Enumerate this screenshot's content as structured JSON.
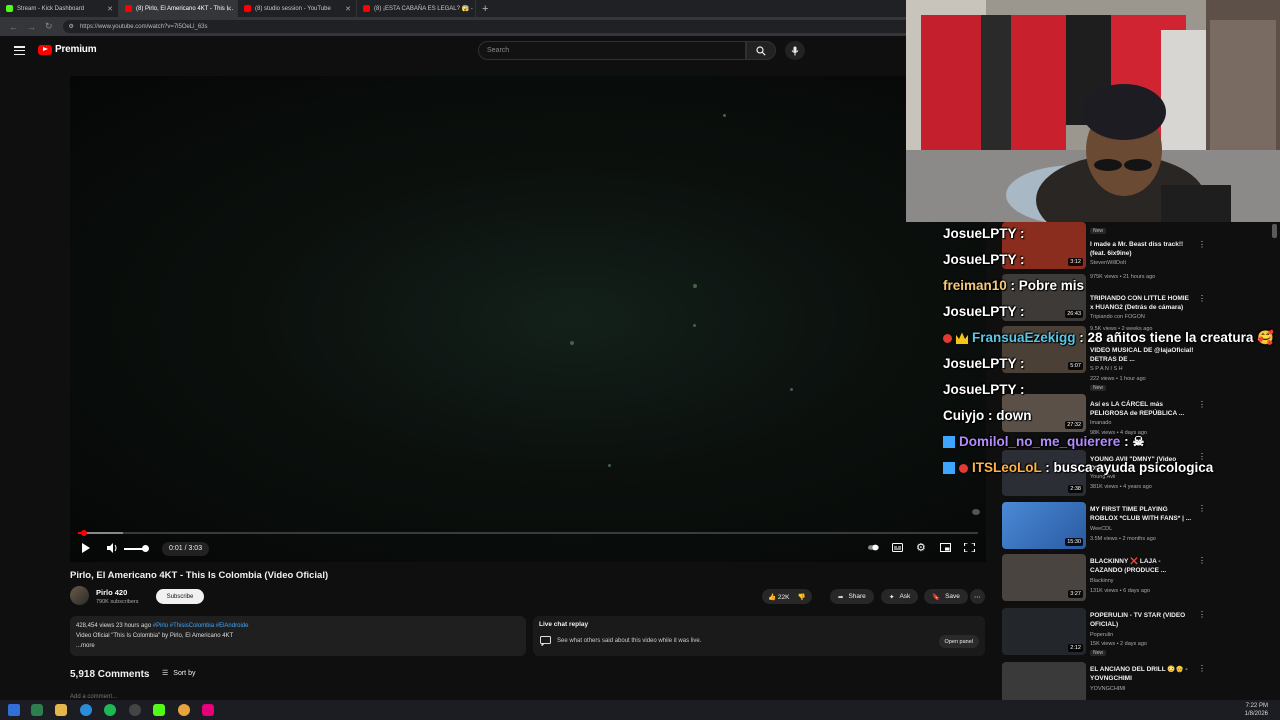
{
  "browser": {
    "tabs": [
      {
        "label": "Stream - Kick Dashboard",
        "color": "#53fc18"
      },
      {
        "label": "(8) Pirlo, El Americano 4KT - This I...",
        "color": "#ff0000"
      },
      {
        "label": "(8) studio session - YouTube",
        "color": "#ff0000"
      },
      {
        "label": "(8) ¡ESTA CABAÑA ES LEGAL? 😱 -",
        "color": "#ff0000"
      }
    ],
    "url": "https://www.youtube.com/watch?v=7l5OeLl_63s"
  },
  "yt_header": {
    "logo_text": "Premium",
    "search_placeholder": "Search"
  },
  "player": {
    "time_display": "0:01 / 3:03",
    "progress_fraction": 0.005,
    "buffered_fraction": 0.05,
    "volume_fraction": 1.0
  },
  "video": {
    "title": "Pirlo, El Americano 4KT - This Is Colombia (Video Oficial)",
    "channel_name": "Pirlo 420",
    "subscribers": "790K subscribers",
    "subscribe_label": "Subscribe",
    "likes": "22K",
    "share_label": "Share",
    "ask_label": "Ask",
    "save_label": "Save",
    "description": {
      "stats": "428,454 views  23 hours ago",
      "tags": "#Pirlo #ThisisColombia #ElAndroide",
      "line2": "Video Oficial \"This Is Colombia\" by Pirlo, El Americano 4KT",
      "more": "...more"
    },
    "live_chat": {
      "title": "Live chat replay",
      "desc": "See what others said about this video while it was live.",
      "open": "Open panel"
    },
    "comments_count": "5,918 Comments",
    "sort_label": "Sort by",
    "add_comment": "Add a comment..."
  },
  "recommendations": [
    {
      "title": "I made a Mr. Beast diss track!! (feat. 6ix9ine)",
      "channel": "StevenWillDoIt",
      "meta": "975K views • 21 hours ago",
      "badge": "New",
      "duration": "3:12",
      "thumb_color": "#8a2c1e"
    },
    {
      "title": "TRIPIANDO CON LITTLE HOMIE x HUANG2 (Detrás de cámara)",
      "channel": "Tripiando con FOGON",
      "meta": "9.5K views • 2 weeks ago",
      "badge": "",
      "duration": "26:43",
      "thumb_color": "#3d3a38"
    },
    {
      "title": "VIDEO MUSICAL DE @lajaOficial! DETRAS DE ...",
      "channel": "S P A N I S H",
      "meta": "222 views • 1 hour ago",
      "badge": "New",
      "duration": "5:07",
      "thumb_color": "#4a4036"
    },
    {
      "title": "Así es LA CÁRCEL más PELIGROSA de REPÚBLICA ...",
      "channel": "Imanado",
      "meta": "98K views • 4 days ago",
      "badge": "",
      "duration": "27:32",
      "thumb_color": "#5a5048"
    },
    {
      "title": "YOUNG AVII \"DMNY\" (Video Oficial)",
      "channel": "Young Avii",
      "meta": "381K views • 4 years ago",
      "badge": "",
      "duration": "2:38",
      "thumb_color": "#2b2f35"
    },
    {
      "title": "MY FIRST TIME PLAYING ROBLOX *CLUB WITH FANS* | ...",
      "channel": "WeeCDL",
      "meta": "3.5M views • 2 months ago",
      "badge": "",
      "duration": "15:30",
      "thumb_color": "#3a6fb0"
    },
    {
      "title": "BLACKINNY ❌ LAJA - CAZANDO (PRODUCE ...",
      "channel": "Blackinny",
      "meta": "131K views • 6 days ago",
      "badge": "",
      "duration": "3:27",
      "thumb_color": "#4a4440"
    },
    {
      "title": "POPERULIN - TV STAR (VIDEO OFICIAL)",
      "channel": "Poperulin",
      "meta": "15K views • 2 days ago",
      "badge": "New",
      "duration": "2:12",
      "thumb_color": "#23262a"
    },
    {
      "title": "EL ANCIANO DEL DRILL 😳👴 - YOVNGCHIMI",
      "channel": "YOVNGCHIMI",
      "meta": "",
      "badge": "",
      "duration": "",
      "thumb_color": "#3a3a3a"
    }
  ],
  "chat": [
    {
      "user": "JosueLPTY",
      "sep": " : ",
      "msg": "",
      "color": "#ffffff",
      "badges": []
    },
    {
      "user": "JosueLPTY",
      "sep": " : ",
      "msg": "",
      "color": "#ffffff",
      "badges": []
    },
    {
      "user": "freiman10",
      "sep": " : ",
      "msg": "Pobre mis",
      "color": "#f5c87a",
      "badges": []
    },
    {
      "user": "JosueLPTY",
      "sep": " : ",
      "msg": "",
      "color": "#ffffff",
      "badges": []
    },
    {
      "user": "FransuaEzekigg",
      "sep": " : ",
      "msg": "28 añitos tiene la creatura 🥰",
      "color": "#5bc7e8",
      "badges": [
        "#e53935",
        "#f5c518"
      ]
    },
    {
      "user": "JosueLPTY",
      "sep": " : ",
      "msg": "",
      "color": "#ffffff",
      "badges": []
    },
    {
      "user": "JosueLPTY",
      "sep": " : ",
      "msg": "",
      "color": "#ffffff",
      "badges": []
    },
    {
      "user": "Cuiyjo",
      "sep": " : ",
      "msg": "down",
      "color": "#ffffff",
      "badges": []
    },
    {
      "user": "Domilol_no_me_quierere",
      "sep": " : ",
      "msg": "☠",
      "color": "#b38cff",
      "badges": [
        "#3ea6ff"
      ]
    },
    {
      "user": "ITSLeoLoL",
      "sep": " : ",
      "msg": "busca ayuda psicologica",
      "color": "#ffb347",
      "badges": [
        "#3ea6ff",
        "#e53935"
      ]
    }
  ],
  "clock": {
    "time": "7:22 PM",
    "date": "1/8/2026"
  }
}
